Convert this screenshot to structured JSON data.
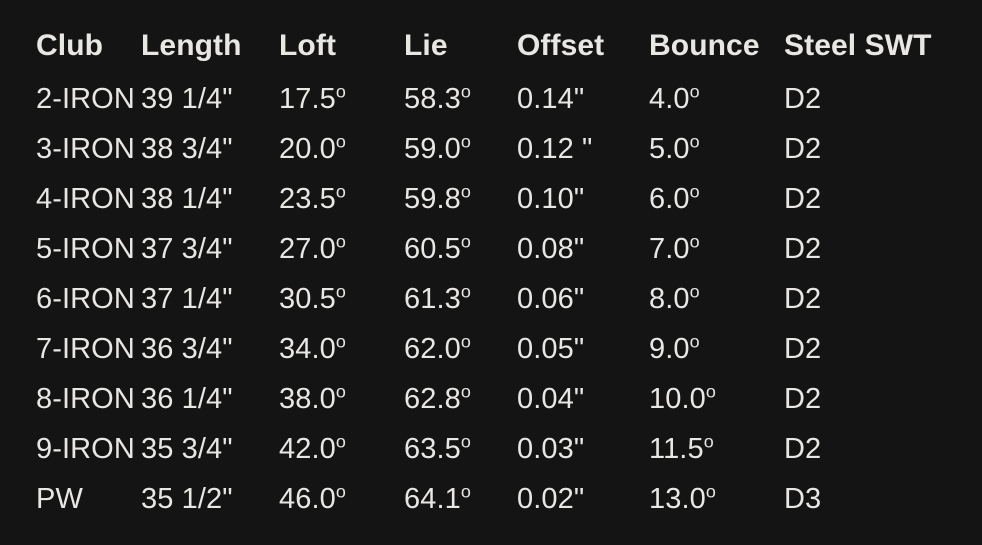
{
  "table": {
    "name": "golf-iron-specifications",
    "theme": {
      "background": "#141414",
      "text": "#e9e7e4"
    },
    "columns": [
      {
        "key": "club",
        "label": "Club"
      },
      {
        "key": "length",
        "label": "Length"
      },
      {
        "key": "loft",
        "label": "Loft"
      },
      {
        "key": "lie",
        "label": "Lie"
      },
      {
        "key": "offset",
        "label": "Offset"
      },
      {
        "key": "bounce",
        "label": "Bounce"
      },
      {
        "key": "swt",
        "label": "Steel SWT"
      }
    ],
    "rows": [
      {
        "club": "2-IRON",
        "length": "39 1/4\"",
        "loft_value": "17.5",
        "loft_unit": "o",
        "lie_value": "58.3",
        "lie_unit": "o",
        "offset": "0.14\"",
        "bounce_value": "4.0",
        "bounce_unit": "o",
        "swt": "D2"
      },
      {
        "club": "3-IRON",
        "length": "38 3/4\"",
        "loft_value": "20.0",
        "loft_unit": "o",
        "lie_value": "59.0",
        "lie_unit": "o",
        "offset": "0.12 \"",
        "bounce_value": "5.0",
        "bounce_unit": "o",
        "swt": "D2"
      },
      {
        "club": "4-IRON",
        "length": "38 1/4\"",
        "loft_value": "23.5",
        "loft_unit": "o",
        "lie_value": "59.8",
        "lie_unit": "o",
        "offset": "0.10\"",
        "bounce_value": "6.0",
        "bounce_unit": "o",
        "swt": "D2"
      },
      {
        "club": "5-IRON",
        "length": "37 3/4\"",
        "loft_value": "27.0",
        "loft_unit": "o",
        "lie_value": "60.5",
        "lie_unit": "o",
        "offset": "0.08\"",
        "bounce_value": "7.0",
        "bounce_unit": "o",
        "swt": "D2"
      },
      {
        "club": "6-IRON",
        "length": "37 1/4\"",
        "loft_value": "30.5",
        "loft_unit": "o",
        "lie_value": "61.3",
        "lie_unit": "o",
        "offset": "0.06\"",
        "bounce_value": "8.0",
        "bounce_unit": "o",
        "swt": "D2"
      },
      {
        "club": "7-IRON",
        "length": "36 3/4\"",
        "loft_value": "34.0",
        "loft_unit": "o",
        "lie_value": "62.0",
        "lie_unit": "o",
        "offset": "0.05\"",
        "bounce_value": "9.0",
        "bounce_unit": "o",
        "swt": "D2"
      },
      {
        "club": "8-IRON",
        "length": "36 1/4\"",
        "loft_value": "38.0",
        "loft_unit": "o",
        "lie_value": "62.8",
        "lie_unit": "o",
        "offset": "0.04\"",
        "bounce_value": "10.0",
        "bounce_unit": "o",
        "swt": "D2"
      },
      {
        "club": "9-IRON",
        "length": "35 3/4\"",
        "loft_value": "42.0",
        "loft_unit": "o",
        "lie_value": "63.5",
        "lie_unit": "o",
        "offset": "0.03\"",
        "bounce_value": "11.5",
        "bounce_unit": "o",
        "swt": "D2"
      },
      {
        "club": "PW",
        "length": "35 1/2\"",
        "loft_value": "46.0",
        "loft_unit": "o",
        "lie_value": "64.1",
        "lie_unit": "o",
        "offset": "0.02\"",
        "bounce_value": "13.0",
        "bounce_unit": "o",
        "swt": "D3"
      }
    ]
  }
}
